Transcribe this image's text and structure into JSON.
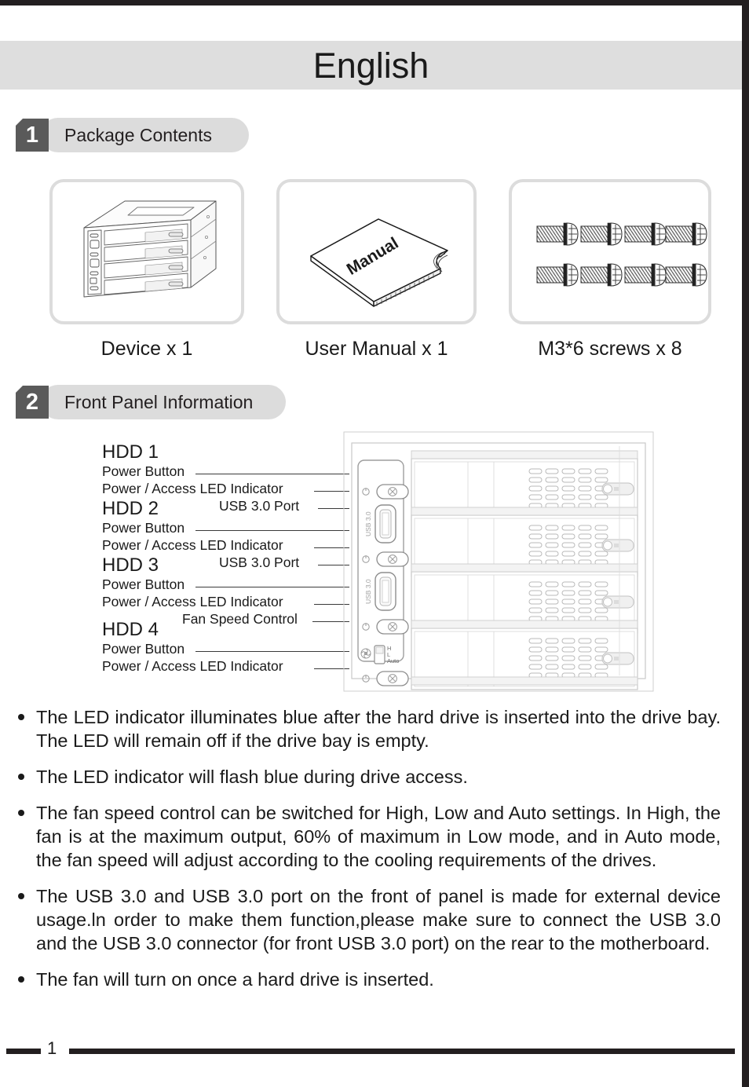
{
  "page": {
    "language_title": "English",
    "page_number": "1"
  },
  "sections": [
    {
      "number": "1",
      "label": "Package Contents"
    },
    {
      "number": "2",
      "label": "Front Panel Information"
    }
  ],
  "package_contents": [
    {
      "icon": "hdd-enclosure-illustration",
      "caption": "Device x 1",
      "artwork_label": ""
    },
    {
      "icon": "user-manual-illustration",
      "caption": "User Manual x 1",
      "artwork_label": "Manual"
    },
    {
      "icon": "screws-illustration",
      "caption": "M3*6 screws x 8",
      "artwork_label": ""
    }
  ],
  "front_panel": {
    "callouts": [
      {
        "id": "hdd1",
        "text": "HDD 1",
        "type": "heading"
      },
      {
        "id": "hdd1-pb",
        "text": "Power Button",
        "type": "sub"
      },
      {
        "id": "hdd1-led",
        "text": "Power / Access LED Indicator",
        "type": "sub"
      },
      {
        "id": "usb1",
        "text": "USB 3.0 Port",
        "type": "sub"
      },
      {
        "id": "hdd2",
        "text": "HDD 2",
        "type": "heading"
      },
      {
        "id": "hdd2-pb",
        "text": "Power Button",
        "type": "sub"
      },
      {
        "id": "hdd2-led",
        "text": "Power / Access LED Indicator",
        "type": "sub"
      },
      {
        "id": "usb2",
        "text": "USB 3.0 Port",
        "type": "sub"
      },
      {
        "id": "hdd3",
        "text": "HDD 3",
        "type": "heading"
      },
      {
        "id": "hdd3-pb",
        "text": "Power Button",
        "type": "sub"
      },
      {
        "id": "hdd3-led",
        "text": "Power / Access LED Indicator",
        "type": "sub"
      },
      {
        "id": "fan",
        "text": "Fan Speed Control",
        "type": "sub"
      },
      {
        "id": "hdd4",
        "text": "HDD 4",
        "type": "heading"
      },
      {
        "id": "hdd4-pb",
        "text": "Power Button",
        "type": "sub"
      },
      {
        "id": "hdd4-led",
        "text": "Power / Access LED Indicator",
        "type": "sub"
      }
    ],
    "panel_markings": {
      "usb_port_label": "USB 3.0",
      "fan_switch_positions": [
        "H",
        "L",
        "Auto"
      ]
    }
  },
  "notes": [
    "The LED indicator illuminates blue after the hard drive is inserted into the drive bay. The LED will remain off if the drive bay is empty.",
    "The LED indicator will flash blue during drive access.",
    "The fan speed control can be switched for High, Low and Auto settings. In High, the fan is at the maximum output, 60% of maximum in Low mode, and in Auto mode, the fan speed will adjust according to the cooling requirements of the drives.",
    "The USB 3.0 and USB 3.0 port on the front of panel is made for external device usage.ln order to make them function,please make sure to connect the USB 3.0 and the USB 3.0 connector (for front USB 3.0 port) on the rear to the motherboard.",
    "The fan will turn on once a hard drive is inserted."
  ],
  "colors": {
    "band_gray": "#dedede",
    "pill_gray": "#dcdcdc",
    "badge_gray": "#5a5a5a",
    "ink": "#1a1a1a",
    "rule_black": "#231f20"
  }
}
